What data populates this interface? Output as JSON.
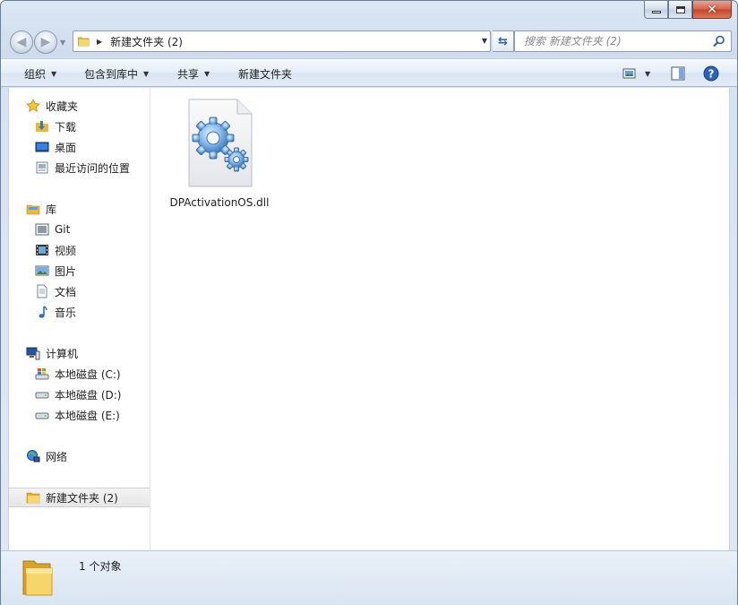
{
  "window": {
    "caption": {
      "minimize": "minimize",
      "maximize": "maximize",
      "close": "close"
    }
  },
  "nav": {
    "back_icon": "back-arrow-icon",
    "forward_icon": "forward-arrow-icon",
    "address": {
      "path": "新建文件夹 (2)"
    },
    "search": {
      "placeholder": "搜索 新建文件夹 (2)"
    }
  },
  "toolbar": {
    "organize": "组织",
    "include_in_library": "包含到库中",
    "share": "共享",
    "new_folder": "新建文件夹"
  },
  "sidebar": {
    "favorites": {
      "label": "收藏夹",
      "icon": "star-icon"
    },
    "favorite_items": [
      {
        "label": "下载",
        "icon": "downloads-icon"
      },
      {
        "label": "桌面",
        "icon": "desktop-icon"
      },
      {
        "label": "最近访问的位置",
        "icon": "recent-places-icon"
      }
    ],
    "libraries": {
      "label": "库",
      "icon": "library-icon"
    },
    "library_items": [
      {
        "label": "Git",
        "icon": "git-library-icon"
      },
      {
        "label": "视频",
        "icon": "video-icon"
      },
      {
        "label": "图片",
        "icon": "pictures-icon"
      },
      {
        "label": "文档",
        "icon": "documents-icon"
      },
      {
        "label": "音乐",
        "icon": "music-icon"
      }
    ],
    "computer": {
      "label": "计算机",
      "icon": "computer-icon"
    },
    "drives": [
      {
        "label": "本地磁盘 (C:)",
        "icon": "system-drive-icon"
      },
      {
        "label": "本地磁盘 (D:)",
        "icon": "drive-icon"
      },
      {
        "label": "本地磁盘 (E:)",
        "icon": "drive-icon"
      }
    ],
    "network": {
      "label": "网络",
      "icon": "network-icon"
    },
    "current_folder": {
      "label": "新建文件夹 (2)",
      "icon": "folder-icon"
    }
  },
  "files": [
    {
      "name": "DPActivationOS.dll",
      "icon": "dll-file-gear-icon"
    }
  ],
  "status": {
    "text": "1 个对象",
    "icon": "folder-icon"
  },
  "colors": {
    "frame": "#d6e3f2",
    "toolbar": "#e3ecf6",
    "close_button": "#c24329",
    "folder": "#f3cf5d",
    "gear": "#6f9fd3"
  }
}
